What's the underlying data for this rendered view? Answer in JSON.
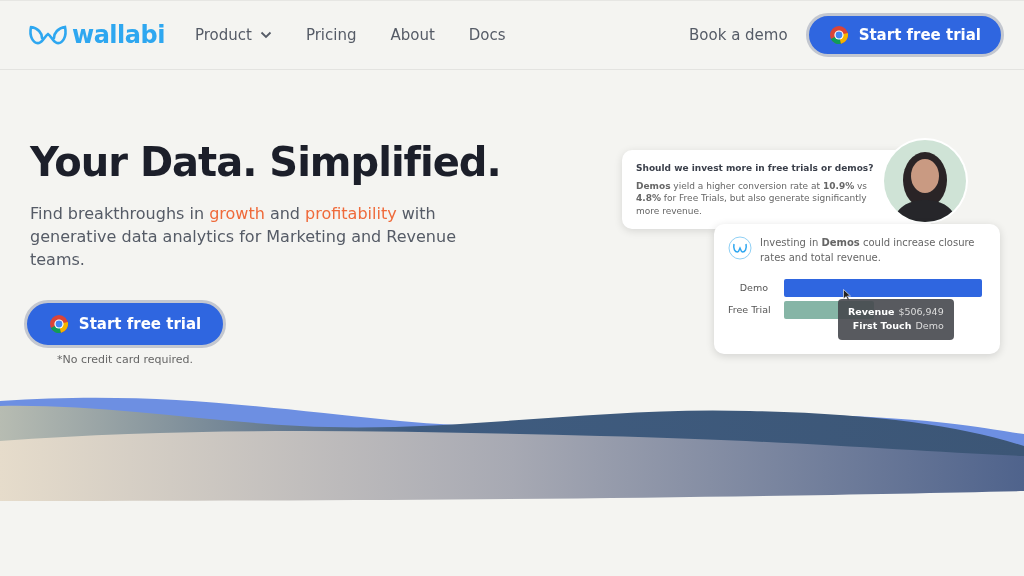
{
  "nav": {
    "brand": "wallabi",
    "links": [
      {
        "label": "Product",
        "dropdown": true
      },
      {
        "label": "Pricing",
        "dropdown": false
      },
      {
        "label": "About",
        "dropdown": false
      },
      {
        "label": "Docs",
        "dropdown": false
      }
    ],
    "demo_link": "Book a demo",
    "cta": "Start free trial"
  },
  "hero": {
    "title": "Your Data. Simplified.",
    "subtitle": "Find breakthroughs in *growth* and *profitability* with generative data analytics for Marketing and Revenue teams.",
    "cta": "Start free trial",
    "note": "*No credit card required."
  },
  "question_card": {
    "question": "Should we invest more in free trials or demos?",
    "answer": "**Demos** yield a higher conversion rate at **10.9%** vs **4.8%** for Free Trials, but also generate significantly more revenue."
  },
  "insight_card": {
    "text": "Investing in **Demos** could increase closure rates and total revenue.",
    "bars": [
      {
        "label": "Demo",
        "color": "#2f66e0"
      },
      {
        "label": "Free Trial",
        "color": "#86b5a6"
      }
    ],
    "tooltip": [
      {
        "key": "Revenue",
        "value": "$506,949"
      },
      {
        "key": "First Touch",
        "value": "Demo"
      }
    ]
  }
}
